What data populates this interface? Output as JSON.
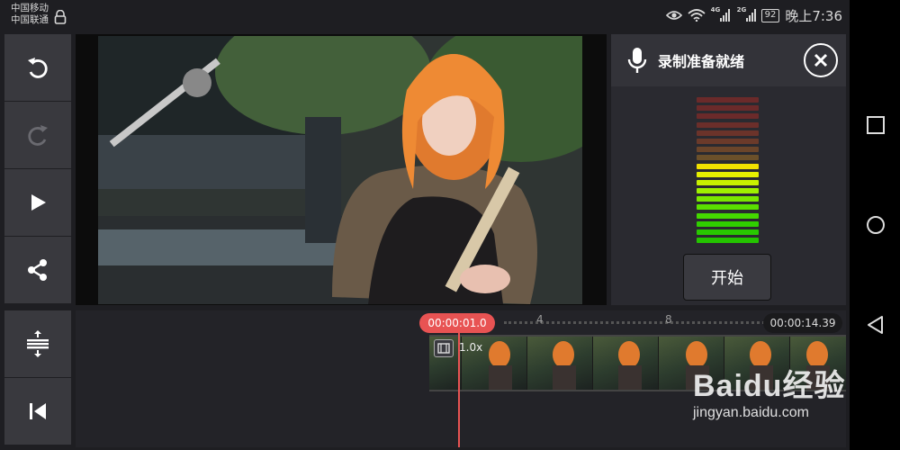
{
  "status_bar": {
    "carrier_1": "中国移动",
    "carrier_2": "中国联通",
    "net_1": "4G",
    "net_2": "2G",
    "battery": "92",
    "time": "晚上7:36"
  },
  "toolbar": {
    "top_icons": [
      "undo-icon",
      "redo-icon",
      "play-icon",
      "share-icon"
    ],
    "bottom_icons": [
      "align-icon",
      "skip-to-start-icon"
    ]
  },
  "recording_panel": {
    "title": "录制准备就绪",
    "start_label": "开始",
    "meter_colors": [
      "#6b2a2a",
      "#6b2a2a",
      "#6b2a2a",
      "#6b2e2a",
      "#6b332a",
      "#6b3a2a",
      "#6b452a",
      "#6b502a",
      "#f0e000",
      "#e6f000",
      "#c8f000",
      "#9ff000",
      "#7ae800",
      "#5ae000",
      "#44d800",
      "#30d000",
      "#28c800",
      "#24c400"
    ]
  },
  "timeline": {
    "current_time": "00:00:01.0",
    "end_time": "00:00:14.39",
    "tick_4": "4",
    "tick_8": "8",
    "speed": "1.0x",
    "playhead_color": "#e85353"
  },
  "watermark": {
    "logo": "Baidu经验",
    "url": "jingyan.baidu.com"
  }
}
